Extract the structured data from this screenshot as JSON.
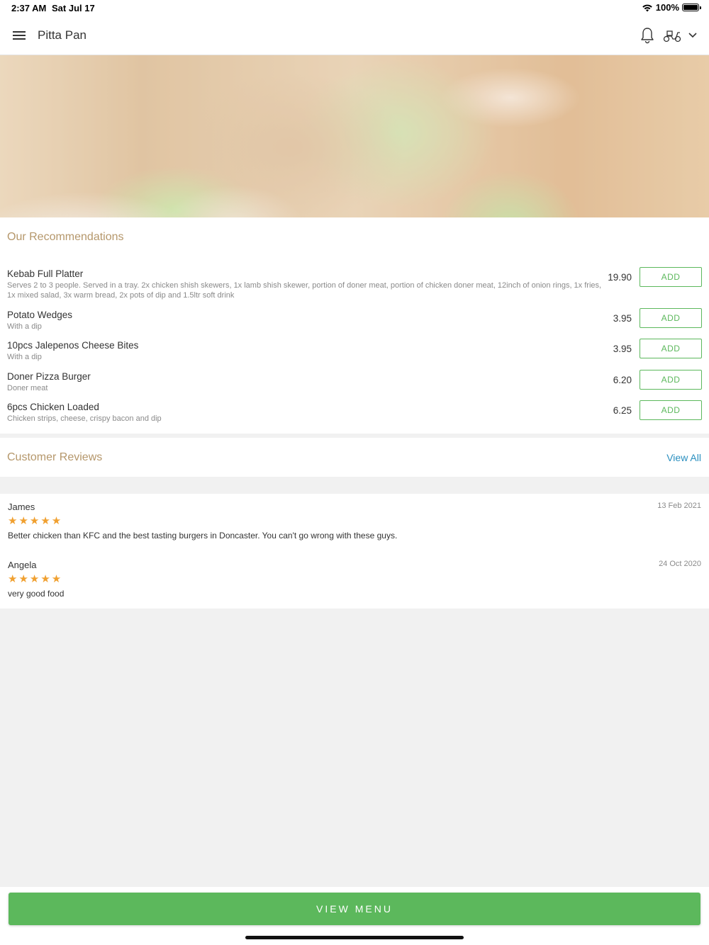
{
  "status_bar": {
    "time": "2:37 AM",
    "date": "Sat Jul 17",
    "battery": "100%"
  },
  "navbar": {
    "title": "Pitta Pan"
  },
  "recommendations": {
    "title": "Our Recommendations",
    "add_label": "ADD",
    "items": [
      {
        "name": "Kebab Full Platter",
        "desc": "Serves 2 to 3 people. Served in a tray. 2x chicken shish skewers, 1x lamb shish skewer, portion of doner meat, portion of chicken doner meat, 12inch of onion rings, 1x fries, 1x mixed salad, 3x warm bread, 2x pots of dip and 1.5ltr soft drink",
        "price": "19.90"
      },
      {
        "name": "Potato Wedges",
        "desc": "With a dip",
        "price": "3.95"
      },
      {
        "name": "10pcs Jalepenos Cheese Bites",
        "desc": "With a dip",
        "price": "3.95"
      },
      {
        "name": "Doner Pizza Burger",
        "desc": "Doner meat",
        "price": "6.20"
      },
      {
        "name": "6pcs Chicken Loaded",
        "desc": "Chicken strips, cheese, crispy bacon and dip",
        "price": "6.25"
      }
    ]
  },
  "reviews": {
    "title": "Customer Reviews",
    "view_all": "View All",
    "items": [
      {
        "name": "James",
        "date": "13 Feb 2021",
        "rating": 5,
        "stars": "★★★★★",
        "text": "Better chicken than KFC and the best tasting burgers in Doncaster. You can't go wrong with these guys."
      },
      {
        "name": "Angela",
        "date": "24 Oct 2020",
        "rating": 5,
        "stars": "★★★★★",
        "text": "very good food"
      }
    ]
  },
  "bottom": {
    "view_menu": "VIEW MENU"
  },
  "colors": {
    "accent_green": "#5cb85c",
    "section_title": "#b5976b",
    "link_blue": "#2a8fbf",
    "star": "#f0a030"
  },
  "icons": [
    "hamburger-menu-icon",
    "bell-icon",
    "scooter-icon",
    "chevron-down-icon",
    "wifi-icon",
    "battery-icon"
  ]
}
